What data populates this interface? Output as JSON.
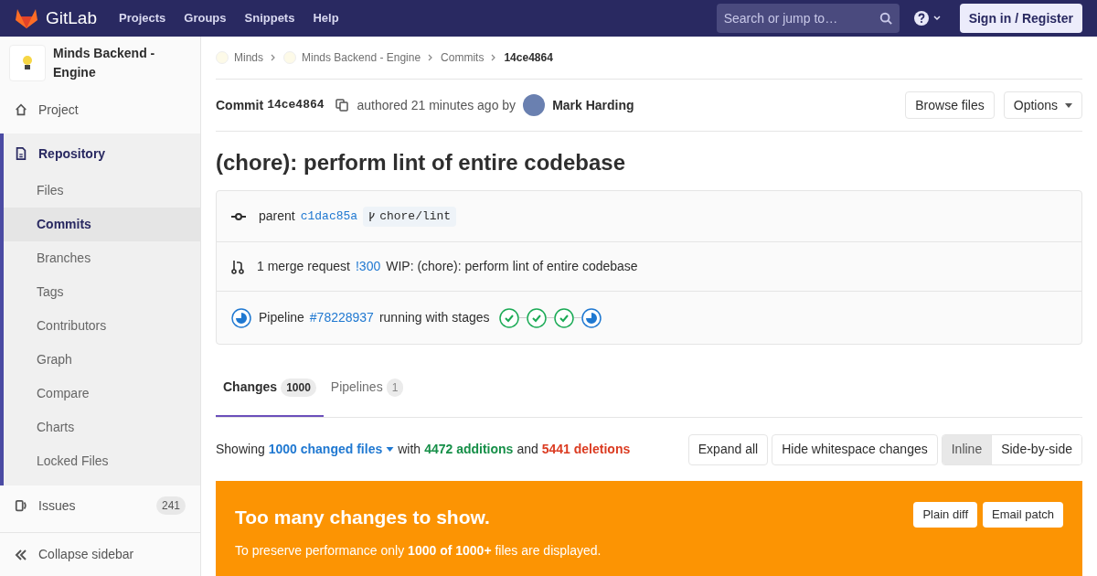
{
  "navbar": {
    "brand": "GitLab",
    "links": [
      "Projects",
      "Groups",
      "Snippets",
      "Help"
    ],
    "search": {
      "placeholder": "Search or jump to…"
    },
    "sign_in": "Sign in / Register"
  },
  "sidebar": {
    "project": "Minds Backend - Engine",
    "items": [
      {
        "label": "Project",
        "kind": "home",
        "selected": false
      },
      {
        "label": "Repository",
        "kind": "file",
        "selected": true,
        "children": [
          {
            "label": "Files",
            "selected": false
          },
          {
            "label": "Commits",
            "selected": true
          },
          {
            "label": "Branches",
            "selected": false
          },
          {
            "label": "Tags",
            "selected": false
          },
          {
            "label": "Contributors",
            "selected": false
          },
          {
            "label": "Graph",
            "selected": false
          },
          {
            "label": "Compare",
            "selected": false
          },
          {
            "label": "Charts",
            "selected": false
          },
          {
            "label": "Locked Files",
            "selected": false
          }
        ]
      },
      {
        "label": "Issues",
        "kind": "issues",
        "selected": false,
        "badge": "241"
      }
    ],
    "collapse": "Collapse sidebar"
  },
  "breadcrumbs": [
    {
      "label": "Minds",
      "avatar": true,
      "current": false
    },
    {
      "label": "Minds Backend - Engine",
      "avatar": true,
      "current": false
    },
    {
      "label": "Commits",
      "avatar": false,
      "current": false
    },
    {
      "label": "14ce4864",
      "avatar": false,
      "current": true
    }
  ],
  "commit": {
    "label": "Commit",
    "sha": "14ce4864",
    "authored": "authored 21 minutes ago by",
    "author": "Mark Harding",
    "buttons": [
      {
        "label": "Browse files",
        "dropdown": false
      },
      {
        "label": "Options",
        "dropdown": true
      }
    ],
    "title": "(chore): perform lint of entire codebase"
  },
  "info": {
    "parent_label": "parent",
    "parent_sha": "c1dac85a",
    "branch": "chore/lint",
    "mr_count": "1 merge request",
    "mr_id": "!300",
    "mr_title": "WIP: (chore): perform lint of entire codebase",
    "pipeline": {
      "kind": "running",
      "label": "Pipeline",
      "id": "#78228937",
      "text": "running with stages"
    },
    "stages": [
      {
        "kind": "success"
      },
      {
        "kind": "success"
      },
      {
        "kind": "success"
      },
      {
        "kind": "running"
      }
    ]
  },
  "tabs": [
    {
      "label": "Changes",
      "count": "1000",
      "selected": true
    },
    {
      "label": "Pipelines",
      "count": "1",
      "selected": false
    }
  ],
  "stats": {
    "showing": "Showing",
    "files": "1000 changed files",
    "with": "with",
    "additions": "4472 additions",
    "and": "and",
    "deletions": "5441 deletions"
  },
  "diff_buttons": [
    "Expand all",
    "Hide whitespace changes"
  ],
  "view_modes": [
    {
      "label": "Inline",
      "selected": true
    },
    {
      "label": "Side-by-side",
      "selected": false
    }
  ],
  "alert": {
    "title": "Too many changes to show.",
    "message": "To preserve performance only **1000 of 1000+** files are displayed.",
    "buttons": [
      "Plain diff",
      "Email patch"
    ]
  }
}
